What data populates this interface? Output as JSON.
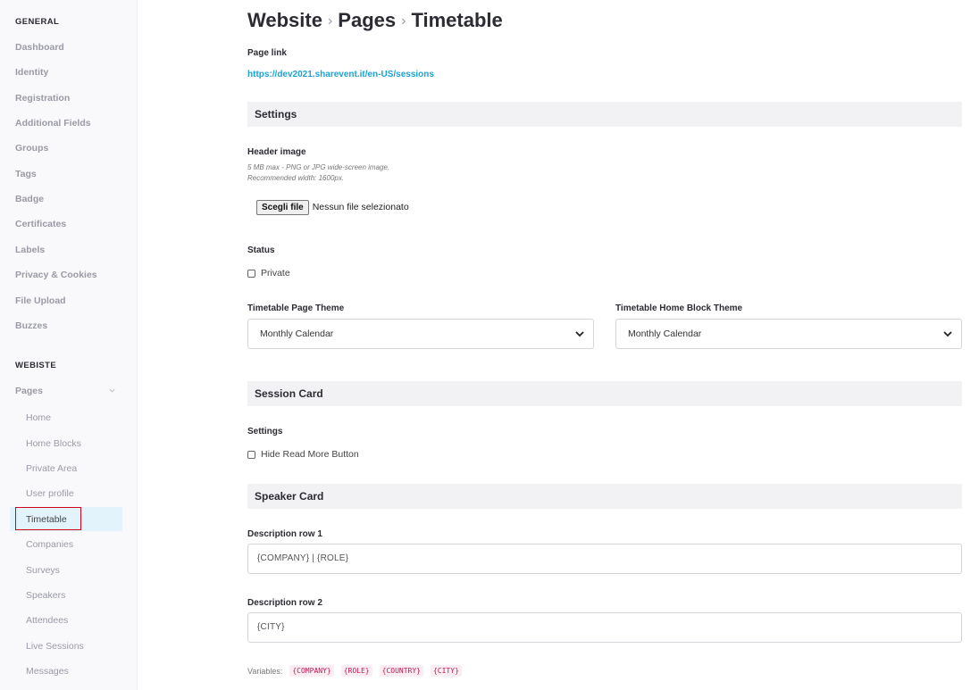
{
  "sidebar": {
    "general_heading": "GENERAL",
    "general_items": [
      "Dashboard",
      "Identity",
      "Registration",
      "Additional Fields",
      "Groups",
      "Tags",
      "Badge",
      "Certificates",
      "Labels",
      "Privacy & Cookies",
      "File Upload",
      "Buzzes"
    ],
    "website_heading": "WEBISTE",
    "pages_label": "Pages",
    "page_items": [
      "Home",
      "Home Blocks",
      "Private Area",
      "User profile",
      "Timetable",
      "Companies",
      "Surveys",
      "Speakers",
      "Attendees",
      "Live Sessions",
      "Messages"
    ],
    "active_page": "Timetable"
  },
  "breadcrumb": {
    "part1": "Website",
    "part2": "Pages",
    "part3": "Timetable",
    "separator": "›"
  },
  "page_link": {
    "label": "Page link",
    "url": "https://dev2021.sharevent.it/en-US/sessions"
  },
  "settings": {
    "title": "Settings",
    "header_image_label": "Header image",
    "header_image_hint1": "5 MB max - PNG or JPG wide-screen image.",
    "header_image_hint2": "Recommended width: 1600px.",
    "file_button": "Scegli file",
    "file_status": "Nessun file selezionato",
    "status_label": "Status",
    "private_label": "Private",
    "page_theme_label": "Timetable Page Theme",
    "page_theme_value": "Monthly Calendar",
    "home_block_theme_label": "Timetable Home Block Theme",
    "home_block_theme_value": "Monthly Calendar"
  },
  "session_card": {
    "title": "Session Card",
    "settings_label": "Settings",
    "hide_read_more_label": "Hide Read More Button"
  },
  "speaker_card": {
    "title": "Speaker Card",
    "row1_label": "Description row 1",
    "row1_value": "{COMPANY} | {ROLE}",
    "row2_label": "Description row 2",
    "row2_value": "{CITY}",
    "variables_label": "Variables:",
    "variables": [
      "{COMPANY}",
      "{ROLE}",
      "{COUNTRY}",
      "{CITY}"
    ]
  },
  "colors": {
    "link": "#1ba3d6",
    "active_highlight": "#e2f3fc",
    "active_border": "#d0021b",
    "variable_chip": "#c2185b"
  }
}
